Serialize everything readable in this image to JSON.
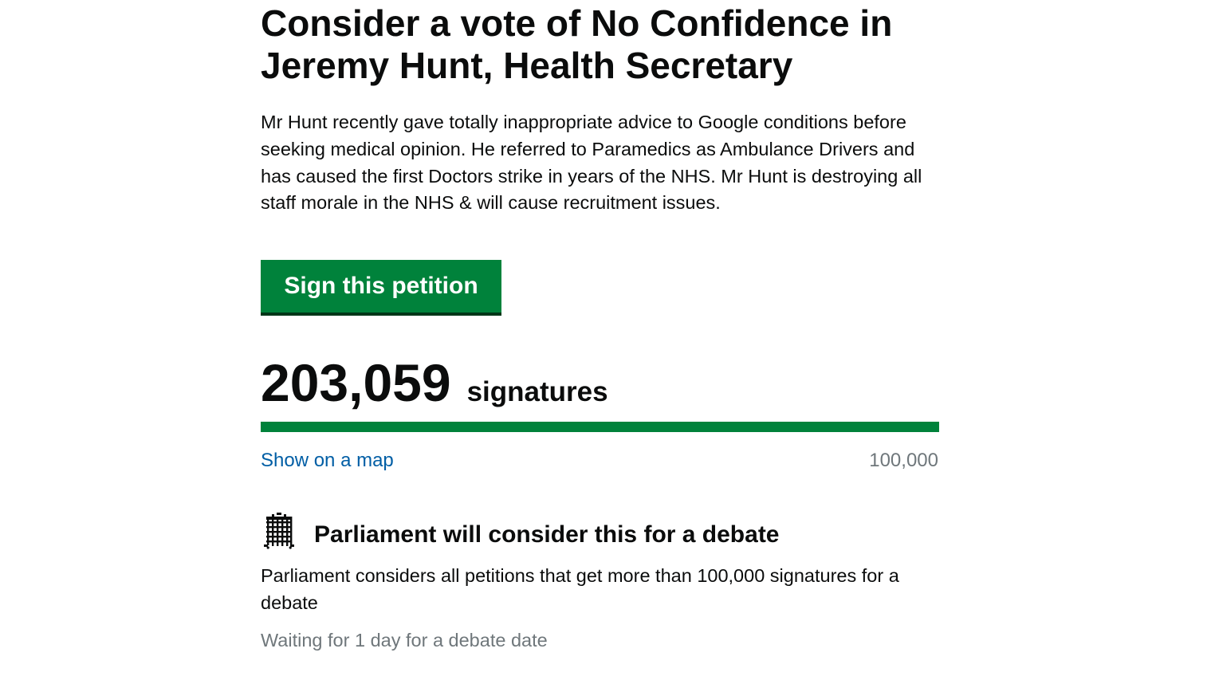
{
  "petition": {
    "title": "Consider a vote of No Confidence in Jeremy Hunt, Health Secretary",
    "description": "Mr Hunt recently gave totally inappropriate advice to Google conditions before seeking medical opinion. He referred to Paramedics as Ambulance Drivers and has caused the first Doctors strike in years of the NHS. Mr Hunt is destroying all staff morale in the NHS & will cause recruitment issues.",
    "sign_button_label": "Sign this petition"
  },
  "signatures": {
    "count": "203,059",
    "label": "signatures",
    "progress_fraction": 1.0,
    "map_link_label": "Show on a map",
    "threshold": "100,000"
  },
  "debate": {
    "icon": "portcullis-icon",
    "heading": "Parliament will consider this for a debate",
    "text": "Parliament considers all petitions that get more than 100,000 signatures for a debate",
    "status": "Waiting for 1 day for a debate date"
  },
  "colors": {
    "primary_green": "#00823b",
    "link_blue": "#005ea5",
    "secondary_text": "#6f777b",
    "text": "#0b0c0c"
  }
}
